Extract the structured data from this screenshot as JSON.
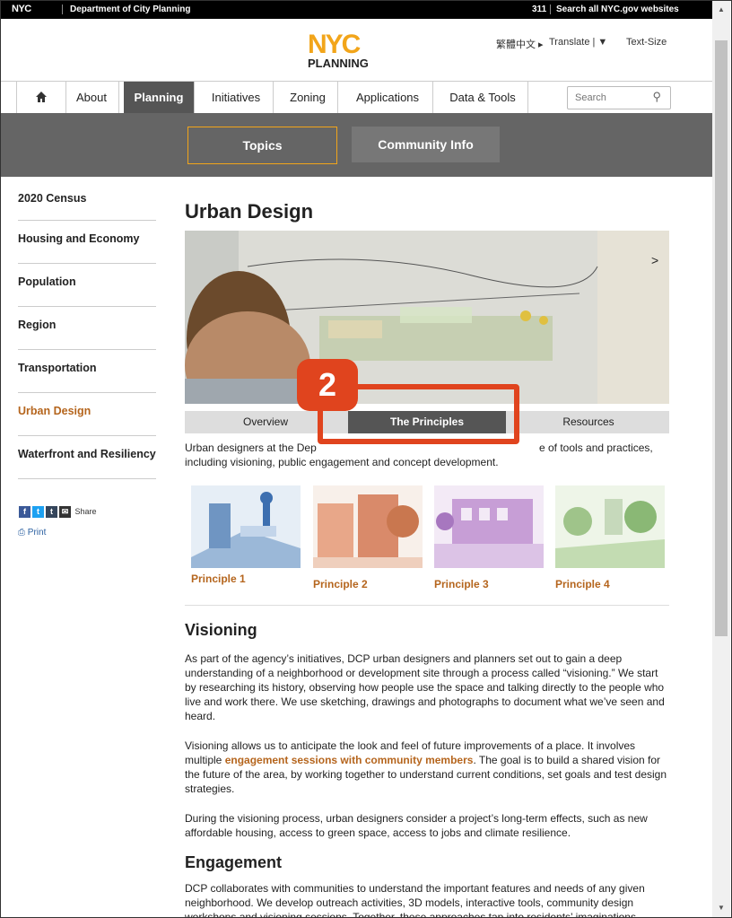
{
  "topbar": {
    "logo": "NYC",
    "department": "Department of City Planning",
    "link_311": "311",
    "search_all": "Search all NYC.gov websites"
  },
  "header": {
    "logo_nyc": "NYC",
    "logo_planning": "PLANNING",
    "languages": "繁體中文 ▸",
    "translate": "Translate | ▼",
    "text_size": "Text-Size"
  },
  "nav": {
    "items": [
      {
        "label": "About"
      },
      {
        "label": "Planning"
      },
      {
        "label": "Initiatives"
      },
      {
        "label": "Zoning"
      },
      {
        "label": "Applications"
      },
      {
        "label": "Data & Tools"
      }
    ],
    "search_placeholder": "Search"
  },
  "band": {
    "topics": "Topics",
    "community": "Community Info"
  },
  "sidebar": {
    "items": [
      {
        "label": "2020 Census"
      },
      {
        "label": "Housing and Economy"
      },
      {
        "label": "Population"
      },
      {
        "label": "Region"
      },
      {
        "label": "Transportation"
      },
      {
        "label": "Urban Design"
      },
      {
        "label": "Waterfront and Resiliency"
      }
    ],
    "share": "Share",
    "print": "Print"
  },
  "main": {
    "title": "Urban Design",
    "tabs": [
      {
        "label": "Overview"
      },
      {
        "label": "The Principles"
      },
      {
        "label": "Resources"
      }
    ],
    "callout_number": "2",
    "intro_a": "Urban designers at the Dep",
    "intro_b": "e of tools and practices,",
    "intro_c": "including visioning, public engagement and concept development.",
    "principles": [
      {
        "label": "Principle 1"
      },
      {
        "label": "Principle 2"
      },
      {
        "label": "Principle 3"
      },
      {
        "label": "Principle 4"
      }
    ],
    "visioning_heading": "Visioning",
    "visioning_p1": "As part of the agency’s initiatives, DCP urban designers and planners set out to gain a deep understanding of a neighborhood or development site through a process called “visioning.” We start by researching its history, observing how people use the space and talking directly to the people who live and work there. We use sketching, drawings and photographs to document what we’ve seen and heard.",
    "visioning_p2_before": "Visioning allows us to anticipate the look and feel of future improvements of a place. It involves multiple ",
    "visioning_p2_link": "engagement sessions with community members",
    "visioning_p2_after": ". The goal is to build a shared vision for the future of the area, by working together to understand current conditions, set goals and test design strategies.",
    "visioning_p3": "During the visioning process, urban designers consider a project’s long-term effects, such as new affordable housing, access to green space, access to jobs and climate resilience.",
    "engagement_heading": "Engagement",
    "engagement_p1": "DCP collaborates with communities to understand the important features and needs of any given neighborhood. We develop outreach activities, 3D models, interactive tools, community design workshops and visioning sessions. Together, these approaches tap into residents’ imaginations"
  },
  "colors": {
    "accent_orange": "#f2a51a",
    "link_brown": "#b5651d",
    "callout_red": "#e0441e",
    "band_gray": "#656565"
  }
}
